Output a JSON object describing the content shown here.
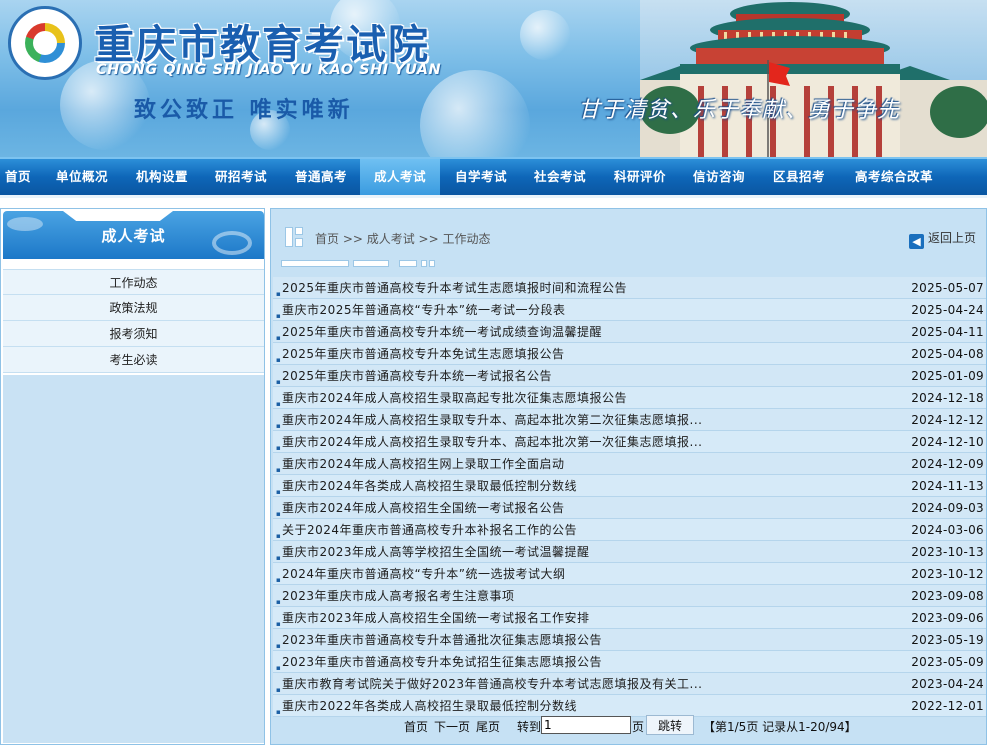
{
  "header": {
    "title": "重庆市教育考试院",
    "pinyin": "CHONG QING SHI JIAO YU KAO SHI YUAN",
    "motto": "致公致正   唯实唯新",
    "slogan": "甘于清贫、乐于奉献、勇于争先",
    "logo_icon": "exam-institute-logo"
  },
  "nav": {
    "items": [
      "首页",
      "单位概况",
      "机构设置",
      "研招考试",
      "普通高考",
      "成人考试",
      "自学考试",
      "社会考试",
      "科研评价",
      "信访咨询",
      "区县招考",
      "高考综合改革"
    ],
    "active": "成人考试"
  },
  "sidebar": {
    "title": "成人考试",
    "items": [
      "工作动态",
      "政策法规",
      "报考须知",
      "考生必读"
    ]
  },
  "main": {
    "breadcrumb": "首页 >> 成人考试 >> 工作动态",
    "back_label": "返回上页",
    "news": [
      {
        "title": "2025年重庆市普通高校专升本考试生志愿填报时间和流程公告",
        "date": "2025-05-07"
      },
      {
        "title": "重庆市2025年普通高校“专升本”统一考试一分段表",
        "date": "2025-04-24"
      },
      {
        "title": "2025年重庆市普通高校专升本统一考试成绩查询温馨提醒",
        "date": "2025-04-11"
      },
      {
        "title": "2025年重庆市普通高校专升本免试生志愿填报公告",
        "date": "2025-04-08"
      },
      {
        "title": "2025年重庆市普通高校专升本统一考试报名公告",
        "date": "2025-01-09"
      },
      {
        "title": "重庆市2024年成人高校招生录取高起专批次征集志愿填报公告",
        "date": "2024-12-18"
      },
      {
        "title": "重庆市2024年成人高校招生录取专升本、高起本批次第二次征集志愿填报...",
        "date": "2024-12-12"
      },
      {
        "title": "重庆市2024年成人高校招生录取专升本、高起本批次第一次征集志愿填报...",
        "date": "2024-12-10"
      },
      {
        "title": "重庆市2024年成人高校招生网上录取工作全面启动",
        "date": "2024-12-09"
      },
      {
        "title": "重庆市2024年各类成人高校招生录取最低控制分数线",
        "date": "2024-11-13"
      },
      {
        "title": "重庆市2024年成人高校招生全国统一考试报名公告",
        "date": "2024-09-03"
      },
      {
        "title": "关于2024年重庆市普通高校专升本补报名工作的公告",
        "date": "2024-03-06"
      },
      {
        "title": "重庆市2023年成人高等学校招生全国统一考试温馨提醒",
        "date": "2023-10-13"
      },
      {
        "title": "2024年重庆市普通高校“专升本”统一选拔考试大纲",
        "date": "2023-10-12"
      },
      {
        "title": "2023年重庆市成人高考报名考生注意事项",
        "date": "2023-09-08"
      },
      {
        "title": "重庆市2023年成人高校招生全国统一考试报名工作安排",
        "date": "2023-09-06"
      },
      {
        "title": "2023年重庆市普通高校专升本普通批次征集志愿填报公告",
        "date": "2023-05-19"
      },
      {
        "title": "2023年重庆市普通高校专升本免试招生征集志愿填报公告",
        "date": "2023-05-09"
      },
      {
        "title": "重庆市教育考试院关于做好2023年普通高校专升本考试志愿填报及有关工...",
        "date": "2023-04-24"
      },
      {
        "title": "重庆市2022年各类成人高校招生录取最低控制分数线",
        "date": "2022-12-01"
      }
    ]
  },
  "pager": {
    "first": "首页",
    "next": "下一页",
    "last": "尾页",
    "goto_label": "转到",
    "page_value": "1",
    "page_unit": "页",
    "jump_label": "跳转",
    "info": "【第1/5页  记录从1-20/94】"
  },
  "colors": {
    "nav_bg": "#0e66b8",
    "nav_active": "#3a9be0",
    "panel_bg": "#c6e1f4",
    "title_blue": "#1a5fb0"
  }
}
